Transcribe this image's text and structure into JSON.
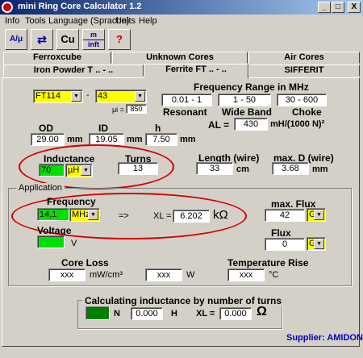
{
  "title": "mini Ring Core Calculator 1.2",
  "window_buttons": {
    "minimize": "_",
    "maximize": "□",
    "close": "X"
  },
  "menu": [
    "Info",
    "Tools",
    "Language (Sprache)",
    "Units",
    "Help"
  ],
  "toolbar": {
    "btn1": "A/μ",
    "btn2": "⇄",
    "btn3": "Cu",
    "btn4_top": "m",
    "btn4_bottom": "inft",
    "btn5": "?"
  },
  "tabs_row1": [
    "Ferroxcube",
    "Unknown Cores",
    "Air Cores"
  ],
  "tabs_row2": [
    "Iron Powder T .. - ..",
    "Ferrite FT .. - ..",
    "SIFFERIT"
  ],
  "core": {
    "type": "FT114",
    "dash": "-",
    "material": "43",
    "mu_label": "μi =",
    "mu_value": "850"
  },
  "frequency_range": {
    "title": "Frequency Range in MHz",
    "ranges": [
      "0.01 - 1",
      "1 - 50",
      "30 - 600"
    ],
    "labels": [
      "Resonant",
      "Wide Band",
      "Choke"
    ],
    "al_label": "AL =",
    "al_value": "430",
    "al_unit": "mH/(1000 N)²"
  },
  "dims": {
    "od_label": "OD",
    "od_value": "29.00",
    "od_unit": "mm",
    "id_label": "ID",
    "id_value": "19.05",
    "id_unit": "mm",
    "h_label": "h",
    "h_value": "7.50",
    "h_unit": "mm"
  },
  "inductance": {
    "label": "Inductance",
    "value": "70",
    "unit": "µH"
  },
  "turns": {
    "label": "Turns",
    "value": "13"
  },
  "length": {
    "label": "Length (wire)",
    "value": "33",
    "unit": "cm"
  },
  "maxd": {
    "label": "max. D (wire)",
    "value": "3.68",
    "unit": "mm"
  },
  "application": {
    "title": "Application",
    "freq_label": "Frequency",
    "freq_value": "14,1",
    "freq_unit": "MHz",
    "arrow": "=>",
    "xl_label": "XL =",
    "xl_value": "6.202",
    "xl_unit": "kΩ",
    "voltage_label": "Voltage",
    "voltage_unit": "V",
    "maxflux_label": "max. Flux",
    "maxflux_value": "42",
    "maxflux_unit": "G",
    "flux_label": "Flux",
    "flux_value": "0",
    "flux_unit": "G",
    "coreloss_label": "Core Loss",
    "coreloss_value": "xxx",
    "coreloss_unit": "mW/cm³",
    "watt_value": "xxx",
    "watt_unit": "W",
    "temprise_label": "Temperature Rise",
    "temprise_value": "xxx",
    "temprise_unit": "°C"
  },
  "calc_turns": {
    "title": "Calculating inductance by number of turns",
    "n_label": "N",
    "h_value": "0.000",
    "h_unit": "H",
    "xl_label": "XL =",
    "xl_value": "0.000",
    "xl_unit": "Ω"
  },
  "supplier": "Supplier: AMIDON",
  "colors": {
    "highlight_green": "#00e000",
    "highlight_yellow": "#ffff00",
    "annotation_red": "#d00000",
    "supplier_blue": "#0000c0"
  }
}
